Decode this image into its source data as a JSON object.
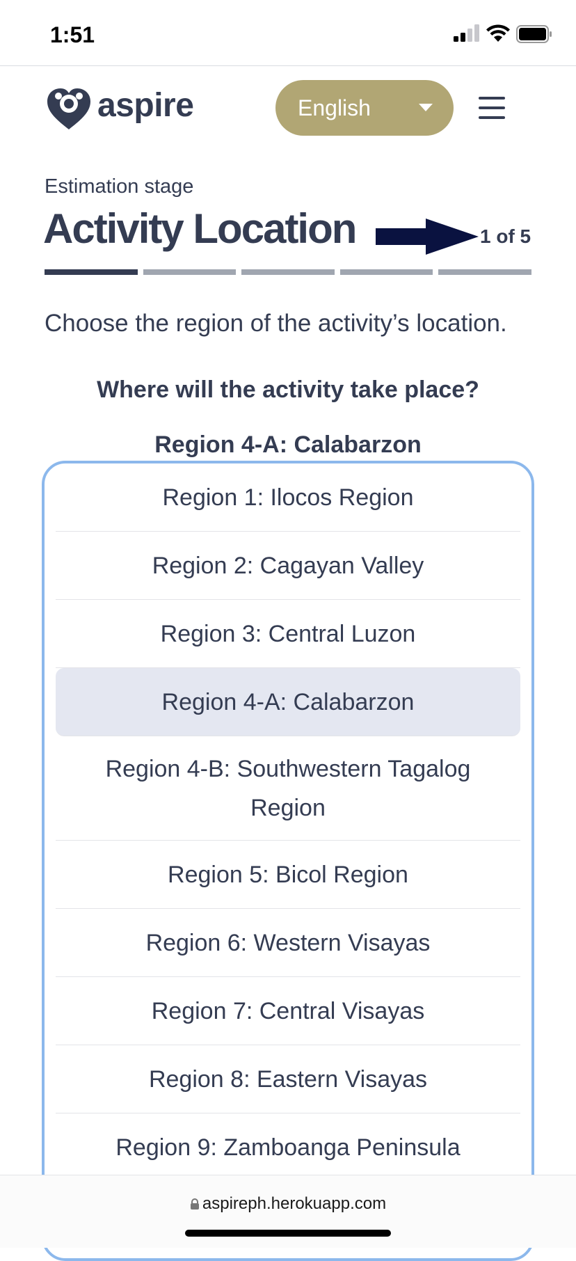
{
  "status_bar": {
    "time": "1:51"
  },
  "header": {
    "logo_text": "aspire",
    "language": {
      "selected": "English"
    }
  },
  "stage": {
    "label": "Estimation stage",
    "title": "Activity Location",
    "step": "1 of 5",
    "progress": {
      "current": 1,
      "total": 5
    }
  },
  "instruction": "Choose the region of the activity’s location.",
  "question": "Where will the activity take place?",
  "selected_region": "Region 4-A: Calabarzon",
  "regions": [
    "Region 1: Ilocos Region",
    "Region 2: Cagayan Valley",
    "Region 3: Central Luzon",
    "Region 4-A: Calabarzon",
    "Region 4-B: Southwestern Tagalog Region",
    "Region 5: Bicol Region",
    "Region 6: Western Visayas",
    "Region 7: Central Visayas",
    "Region 8: Eastern Visayas",
    "Region 9: Zamboanga Peninsula"
  ],
  "url_bar": {
    "domain": "aspireph.herokuapp.com"
  },
  "colors": {
    "text_primary": "#343c52",
    "language_button": "#b1a674",
    "listbox_border": "#8cb8ec",
    "selected_option_bg": "#e4e7f1",
    "arrow": "#0a1240"
  }
}
